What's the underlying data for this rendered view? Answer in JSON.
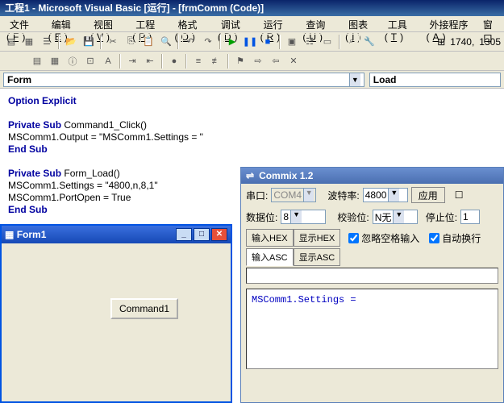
{
  "main": {
    "title": "工程1 - Microsoft Visual Basic [运行] - [frmComm (Code)]"
  },
  "menu": {
    "items": [
      {
        "t": "文件",
        "k": "F"
      },
      {
        "t": "编辑",
        "k": "E"
      },
      {
        "t": "视图",
        "k": "V"
      },
      {
        "t": "工程",
        "k": "P"
      },
      {
        "t": "格式",
        "k": "O"
      },
      {
        "t": "调试",
        "k": "D"
      },
      {
        "t": "运行",
        "k": "R"
      },
      {
        "t": "查询",
        "k": "U"
      },
      {
        "t": "图表",
        "k": "I"
      },
      {
        "t": "工具",
        "k": "T"
      },
      {
        "t": "外接程序",
        "k": "A"
      },
      {
        "t": "窗口"
      }
    ]
  },
  "status": {
    "ln": "1740,",
    "col": "1305"
  },
  "combos": {
    "left": "Form",
    "right": "Load"
  },
  "code": {
    "l1": "Option Explicit",
    "l2a": "Private Sub",
    "l2b": " Command1_Click()",
    "l3": "    MSComm1.Output = \"MSComm1.Settings = \"",
    "l4": "End Sub",
    "l5a": "Private Sub",
    "l5b": " Form_Load()",
    "l6": "    MSComm1.Settings = \"4800,n,8,1\"",
    "l7": "    MSComm1.PortOpen = True",
    "l8": "End Sub"
  },
  "form1": {
    "title": "Form1",
    "button": "Command1"
  },
  "commix": {
    "title": "Commix 1.2",
    "labels": {
      "port": "串口:",
      "baud": "波特率:",
      "apply": "应用",
      "databits": "数据位:",
      "parity": "校验位:",
      "stopbits": "停止位:",
      "ignoreSpace": "忽略空格输入",
      "autoWrap": "自动换行"
    },
    "values": {
      "port": "COM4",
      "baud": "4800",
      "databits": "8",
      "parity": "N无",
      "stopbits": "1"
    },
    "tabs": {
      "inHex": "输入HEX",
      "dispHex": "显示HEX",
      "inAsc": "输入ASC",
      "dispAsc": "显示ASC"
    },
    "terminal": "MSComm1.Settings ="
  }
}
